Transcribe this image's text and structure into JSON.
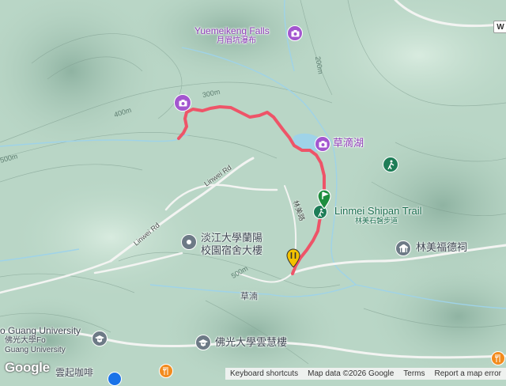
{
  "map": {
    "background": "#b9d6c6",
    "route_color": "#ee5468",
    "poi_purple": "#8e3fb7",
    "poi_green": "#1b6e4f"
  },
  "labels": {
    "falls_en": "Yuemeikeng Falls",
    "falls_zh": "月眉坑瀑布",
    "lake_zh": "草滴湖",
    "trail_en": "Linmei Shipan Trail",
    "trail_zh": "林美石磐步道",
    "temple_zh": "林美福德祠",
    "dorm_line1": "淡江大學蘭陽",
    "dorm_line2": "校園宿舍大樓",
    "village_zh": "草湳",
    "university_en_1": "o Guang University",
    "university_zh": "佛光大學Fo",
    "university_en_2": "Guang University",
    "building_zh": "佛光大學雲慧樓",
    "cafe_zh": "雲起咖啡",
    "corner_w": "W"
  },
  "roads": {
    "linwei_rd_1": "Linwei Rd",
    "linwei_rd_2": "Linwei Rd",
    "linmei_rd_zh": "林美路"
  },
  "contours": {
    "c200": "200m",
    "c300": "300m",
    "c400": "400m",
    "c500_a": "500m",
    "c500_b": "500m"
  },
  "footer": {
    "keyboard": "Keyboard shortcuts",
    "mapdata": "Map data ©2026 Google",
    "terms": "Terms",
    "report": "Report a map error"
  },
  "brand": "Google",
  "icons": {
    "camera": "camera-icon",
    "start_flag": "flag-icon",
    "end_marker": "finish-marker-icon",
    "hiking": "hiking-icon",
    "temple": "temple-icon",
    "pin": "place-pin-icon",
    "school": "school-icon",
    "food": "restaurant-icon"
  }
}
